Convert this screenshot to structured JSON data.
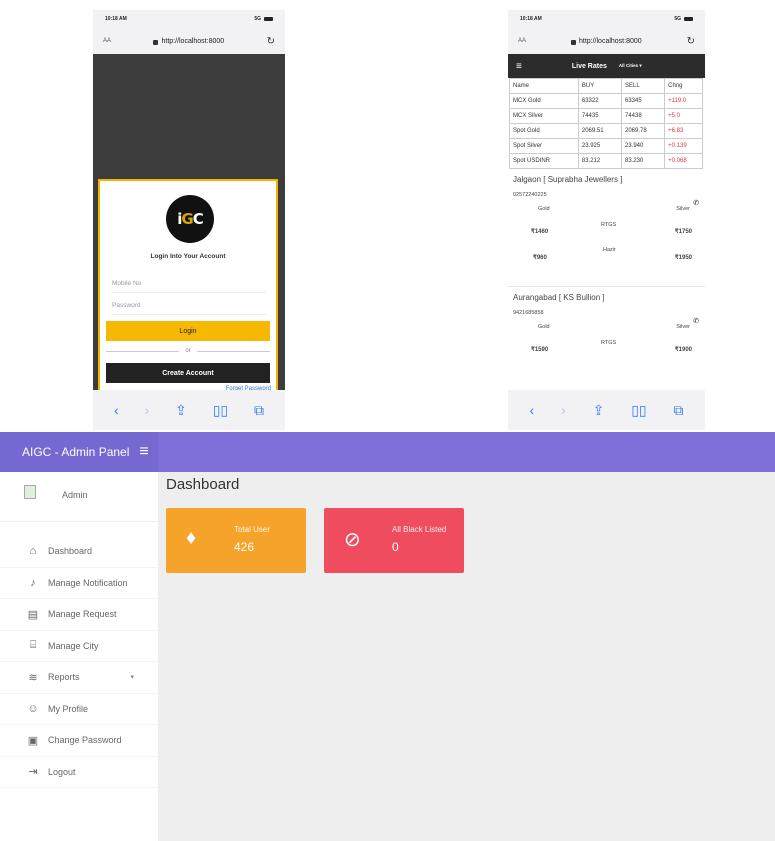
{
  "phone_left": {
    "status": {
      "time": "10:18 AM",
      "network": "5G"
    },
    "browser": {
      "aa": "AA",
      "url": "http://localhost:8000"
    },
    "login": {
      "title": "Login Into Your Account",
      "mobile_placeholder": "Mobile No",
      "password_placeholder": "Password",
      "login_label": "Login",
      "or_label": "or",
      "create_label": "Create Account",
      "forgot_label": "Forget Password"
    }
  },
  "phone_right": {
    "status": {
      "time": "10:18 AM",
      "network": "5G"
    },
    "browser": {
      "aa": "AA",
      "url": "http://localhost:8000"
    },
    "header": {
      "title": "Live Rates",
      "city_filter": "All Cities ▾"
    },
    "table": {
      "headers": [
        "Name",
        "BUY",
        "SELL",
        "Chng"
      ],
      "rows": [
        [
          "MCX Gold",
          "63322",
          "63345",
          "+119.0"
        ],
        [
          "MCX Silver",
          "74435",
          "74438",
          "+5.0"
        ],
        [
          "Spot Gold",
          "2069.51",
          "2069.78",
          "+6.83"
        ],
        [
          "Spot Silver",
          "23.925",
          "23.940",
          "+0.139"
        ],
        [
          "Spot USDINR",
          "83.212",
          "83.230",
          "+0.068"
        ]
      ]
    },
    "jewellers": [
      {
        "name": "Jalgaon [ Suprabha Jewellers ]",
        "phone": "02572240225",
        "gold_label": "Gold",
        "silver_label": "Silver",
        "row1_label": "RTGS",
        "row1_gold": "₹1460",
        "row1_silver": "₹1750",
        "row2_label": "Hazir",
        "row2_gold": "₹960",
        "row2_silver": "₹1950"
      },
      {
        "name": "Aurangabad [ KS Bullion ]",
        "phone": "9421685858",
        "gold_label": "Gold",
        "silver_label": "Silver",
        "row1_label": "RTGS",
        "row1_gold": "₹1590",
        "row1_silver": "₹1900"
      }
    ]
  },
  "admin": {
    "brand": "AIGC - Admin Panel",
    "user_name": "Admin",
    "nav": [
      {
        "label": "Dashboard",
        "icon": "home-icon"
      },
      {
        "label": "Manage Notification",
        "icon": "bell-icon"
      },
      {
        "label": "Manage Request",
        "icon": "request-icon"
      },
      {
        "label": "Manage City",
        "icon": "city-icon"
      },
      {
        "label": "Reports",
        "icon": "reports-icon"
      },
      {
        "label": "My Profile",
        "icon": "user-icon"
      },
      {
        "label": "Change Password",
        "icon": "lock-icon"
      },
      {
        "label": "Logout",
        "icon": "logout-icon"
      }
    ],
    "page_title": "Dashboard",
    "cards": [
      {
        "label": "Total User",
        "value": "426",
        "icon": "diamond-icon",
        "color": "#f5a32a"
      },
      {
        "label": "All Black Listed",
        "value": "0",
        "icon": "user-blocked-icon",
        "color": "#ef4c5f"
      }
    ],
    "colors": {
      "topbar": "#7f6fd8",
      "accent_yellow": "#f6b800"
    }
  }
}
